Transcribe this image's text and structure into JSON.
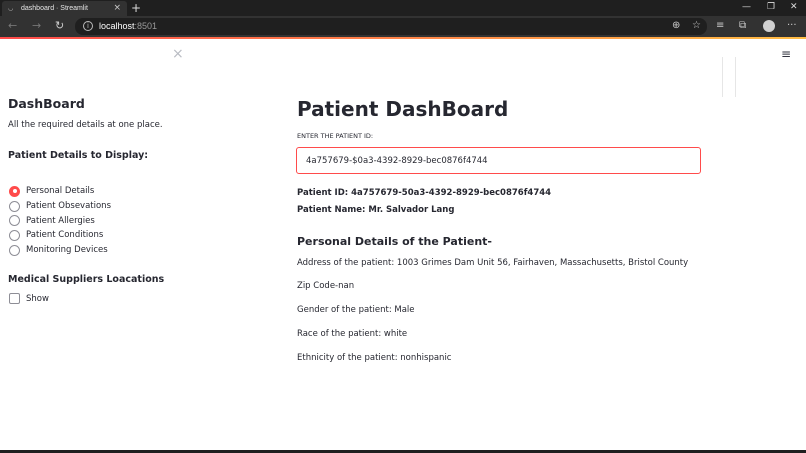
{
  "browser": {
    "tab_title": "dashboard · Streamlit",
    "favicon_glyph": "◡",
    "tab_close": "×",
    "new_tab": "+",
    "url_host": "localhost",
    "url_port": ":8501",
    "info_glyph": "i",
    "icons": {
      "back": "←",
      "forward": "→",
      "reload": "↻",
      "zoom": "⊕",
      "star": "☆",
      "favorites": "≡",
      "collections": "⧉",
      "more": "···",
      "minimize": "—",
      "restore": "❐",
      "close": "✕"
    }
  },
  "sidebar": {
    "close_glyph": "×",
    "title": "DashBoard",
    "subtitle": "All the required details at one place.",
    "radio_heading": "Patient Details to Display:",
    "options": [
      "Personal Details",
      "Patient Obsevations",
      "Patient Allergies",
      "Patient Conditions",
      "Monitoring Devices"
    ],
    "selected_index": 0,
    "suppliers_heading": "Medical Suppliers Loacations",
    "checkbox_label": "Show"
  },
  "main": {
    "menu_glyph": "≡",
    "title": "Patient DashBoard",
    "input_label": "ENTER THE PATIENT ID:",
    "input_value": "4a757679-$0a3-4392-8929-bec0876f4744",
    "patient_id_line": "Patient ID: 4a757679-50a3-4392-8929-bec0876f4744",
    "patient_name_line": "Patient Name: Mr. Salvador Lang",
    "section_heading": "Personal Details of the Patient-",
    "details": [
      "Address of the patient: 1003 Grimes Dam Unit 56, Fairhaven, Massachusetts, Bristol County",
      "Zip Code-nan",
      "Gender of the patient: Male",
      "Race of the patient: white",
      "Ethnicity of the patient: nonhispanic"
    ]
  },
  "colors": {
    "primary": "#ff4b4b",
    "text": "#262730",
    "browser_dark": "#1f1f1f"
  }
}
